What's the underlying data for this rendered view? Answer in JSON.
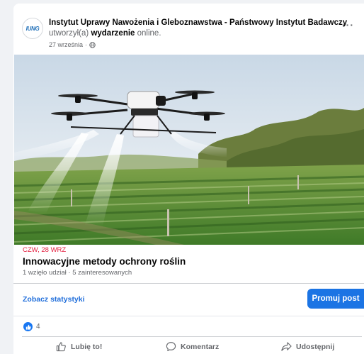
{
  "post": {
    "page_name": "Instytut Uprawy Nawożenia i Gleboznawstwa - Państwowy Instytut Badawczy",
    "action_prefix": "utworzył(a) ",
    "action_bold": "wydarzenie",
    "action_suffix": " online.",
    "date": "27 września",
    "date_sep": "·",
    "avatar_text": "IUNG",
    "more": "···"
  },
  "event": {
    "date": "CZW, 28 WRZ",
    "title": "Innowacyjne metody ochrony roślin",
    "stats": "1 wzięło udział · 5 zainteresowanych"
  },
  "toolbar": {
    "stats_label": "Zobacz statystyki",
    "promote_label": "Promuj post"
  },
  "reactions": {
    "count": "4"
  },
  "actions": {
    "like": "Lubię to!",
    "comment": "Komentarz",
    "share": "Udostępnij"
  },
  "icons": {
    "like": "thumbs-up-icon",
    "comment": "speech-bubble-icon",
    "share": "share-arrow-icon",
    "globe": "globe-icon",
    "more": "more-options-icon"
  },
  "colors": {
    "brand_blue": "#1b74e4",
    "link_blue": "#216fdb",
    "event_date_red": "#e41e3f",
    "muted": "#65676b"
  }
}
